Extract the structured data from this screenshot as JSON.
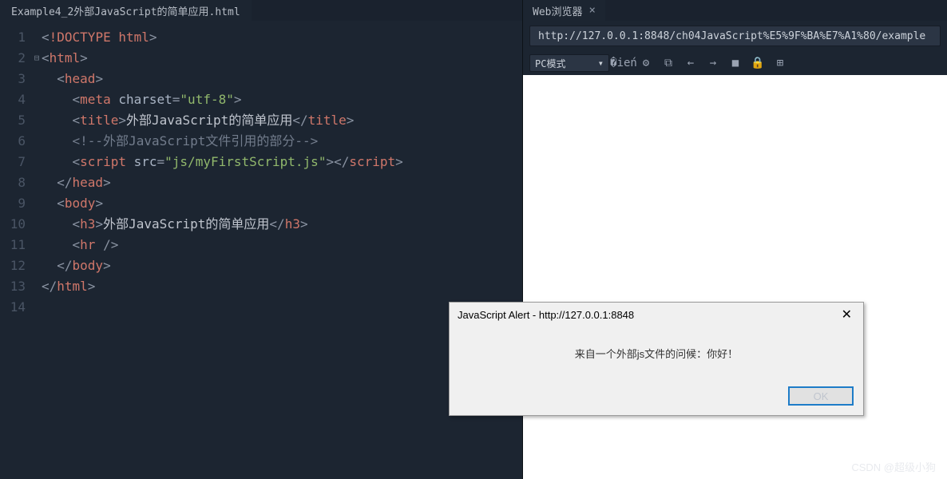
{
  "editor": {
    "tab_title": "Example4_2外部JavaScript的简单应用.html",
    "line_count": 14,
    "code_lines": [
      {
        "indent": 0,
        "tokens": [
          [
            "p",
            "<"
          ],
          [
            "dt",
            "!DOCTYPE html"
          ],
          [
            "p",
            ">"
          ]
        ]
      },
      {
        "indent": 0,
        "tokens": [
          [
            "p",
            "<"
          ],
          [
            "tn",
            "html"
          ],
          [
            "p",
            ">"
          ]
        ]
      },
      {
        "indent": 1,
        "tokens": [
          [
            "p",
            "<"
          ],
          [
            "tn",
            "head"
          ],
          [
            "p",
            ">"
          ]
        ]
      },
      {
        "indent": 2,
        "tokens": [
          [
            "p",
            "<"
          ],
          [
            "tn",
            "meta"
          ],
          [
            "tx",
            " "
          ],
          [
            "an",
            "charset"
          ],
          [
            "p",
            "="
          ],
          [
            "av",
            "\"utf-8\""
          ],
          [
            "p",
            ">"
          ]
        ]
      },
      {
        "indent": 2,
        "tokens": [
          [
            "p",
            "<"
          ],
          [
            "tn",
            "title"
          ],
          [
            "p",
            ">"
          ],
          [
            "tx",
            "外部JavaScript的简单应用"
          ],
          [
            "p",
            "</"
          ],
          [
            "tn",
            "title"
          ],
          [
            "p",
            ">"
          ]
        ]
      },
      {
        "indent": 2,
        "tokens": [
          [
            "cm",
            "<!--外部JavaScript文件引用的部分-->"
          ]
        ]
      },
      {
        "indent": 2,
        "tokens": [
          [
            "p",
            "<"
          ],
          [
            "tn",
            "script"
          ],
          [
            "tx",
            " "
          ],
          [
            "an",
            "src"
          ],
          [
            "p",
            "="
          ],
          [
            "av",
            "\"js/myFirstScript.js\""
          ],
          [
            "p",
            ">"
          ],
          [
            "p",
            "</"
          ],
          [
            "tn",
            "script"
          ],
          [
            "p",
            ">"
          ]
        ]
      },
      {
        "indent": 1,
        "tokens": [
          [
            "p",
            "</"
          ],
          [
            "tn",
            "head"
          ],
          [
            "p",
            ">"
          ]
        ]
      },
      {
        "indent": 1,
        "tokens": [
          [
            "p",
            "<"
          ],
          [
            "tn",
            "body"
          ],
          [
            "p",
            ">"
          ]
        ]
      },
      {
        "indent": 2,
        "tokens": [
          [
            "p",
            "<"
          ],
          [
            "tn",
            "h3"
          ],
          [
            "p",
            ">"
          ],
          [
            "tx",
            "外部JavaScript的简单应用"
          ],
          [
            "p",
            "</"
          ],
          [
            "tn",
            "h3"
          ],
          [
            "p",
            ">"
          ]
        ]
      },
      {
        "indent": 2,
        "tokens": [
          [
            "p",
            "<"
          ],
          [
            "tn",
            "hr"
          ],
          [
            "tx",
            " "
          ],
          [
            "p",
            "/>"
          ]
        ]
      },
      {
        "indent": 1,
        "tokens": [
          [
            "p",
            "</"
          ],
          [
            "tn",
            "body"
          ],
          [
            "p",
            ">"
          ]
        ]
      },
      {
        "indent": 0,
        "tokens": [
          [
            "p",
            "</"
          ],
          [
            "tn",
            "html"
          ],
          [
            "p",
            ">"
          ]
        ]
      },
      {
        "indent": 0,
        "tokens": []
      }
    ],
    "fold_markers": {
      "2": "⊟"
    }
  },
  "browser": {
    "tab_title": "Web浏览器",
    "url": "http://127.0.0.1:8848/ch04JavaScript%E5%9F%BA%E7%A1%80/example",
    "mode_label": "PC模式",
    "tool_icons": [
      "phone-icon",
      "gear-icon",
      "open-window-icon",
      "back-icon",
      "forward-icon",
      "stop-icon",
      "lock-icon",
      "qr-icon"
    ]
  },
  "alert": {
    "title": "JavaScript Alert - http://127.0.0.1:8848",
    "message": "来自一个外部js文件的问候：你好！",
    "ok_label": "OK"
  },
  "watermark": "CSDN @超级小狗"
}
